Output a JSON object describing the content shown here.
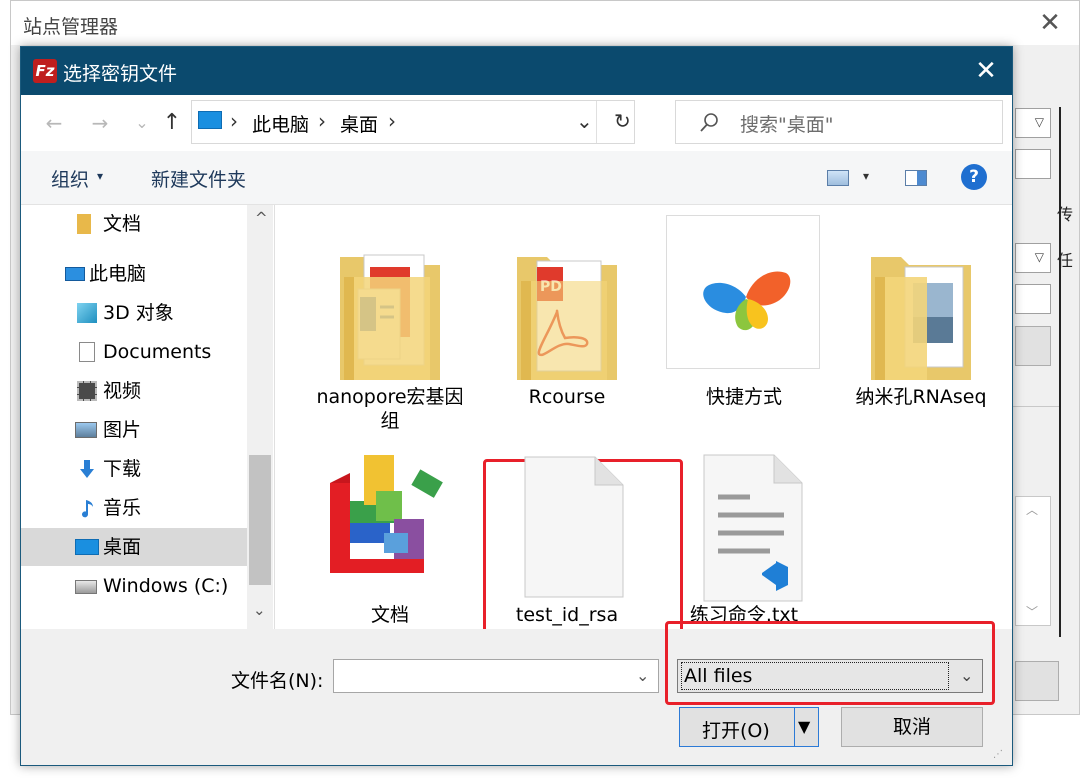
{
  "background_window": {
    "title": "站点管理器",
    "close_glyph": "✕",
    "fragments": [
      "传",
      "任"
    ]
  },
  "dialog": {
    "title": "选择密钥文件",
    "app_logo_text": "Fz",
    "close_glyph": "✕",
    "nav": {
      "back_glyph": "←",
      "forward_glyph": "→",
      "recent_glyph": "⌄",
      "up_glyph": "↑",
      "separator": "›",
      "breadcrumb": [
        "此电脑",
        "桌面"
      ],
      "dropdown_glyph": "⌄",
      "refresh_glyph": "↻",
      "search_placeholder": "搜索\"桌面\""
    },
    "toolbar": {
      "organize_label": "组织",
      "organize_arrow": "▾",
      "new_folder_label": "新建文件夹",
      "view_arrow": "▾",
      "help_glyph": "?"
    },
    "sidebar": {
      "scroll_up_glyph": "^",
      "scroll_down_glyph": "⌄",
      "items": [
        {
          "label": "文档",
          "icon": "folder-icon"
        },
        {
          "label": "此电脑",
          "icon": "computer-icon"
        },
        {
          "label": "3D 对象",
          "icon": "3d-objects-icon"
        },
        {
          "label": "Documents",
          "icon": "document-icon"
        },
        {
          "label": "视频",
          "icon": "video-icon"
        },
        {
          "label": "图片",
          "icon": "pictures-icon"
        },
        {
          "label": "下载",
          "icon": "download-icon"
        },
        {
          "label": "音乐",
          "icon": "music-icon"
        },
        {
          "label": "桌面",
          "icon": "desktop-icon",
          "selected": true
        },
        {
          "label": "Windows (C:)",
          "icon": "drive-icon"
        }
      ]
    },
    "files": [
      {
        "name": "nanopore宏基因组",
        "icon": "folder-with-docs-icon"
      },
      {
        "name": "Rcourse",
        "icon": "folder-with-pdf-icon"
      },
      {
        "name": "快捷方式",
        "icon": "shortcut-butterfly-icon"
      },
      {
        "name": "纳米孔RNAseq",
        "icon": "folder-with-images-icon"
      },
      {
        "name": "文档",
        "icon": "blocks-app-icon"
      },
      {
        "name": "test_id_rsa",
        "icon": "blank-file-icon",
        "highlighted": true
      },
      {
        "name": "练习命令.txt",
        "icon": "text-file-vscode-icon"
      }
    ],
    "bottom": {
      "filename_label": "文件名(N):",
      "filename_value": "",
      "filetype_value": "All files",
      "open_label": "打开(O)",
      "open_arrow": "▼",
      "cancel_label": "取消"
    },
    "colors": {
      "titlebar": "#0b4a6e",
      "highlight": "#e8202a",
      "help": "#1f6fd0"
    }
  }
}
